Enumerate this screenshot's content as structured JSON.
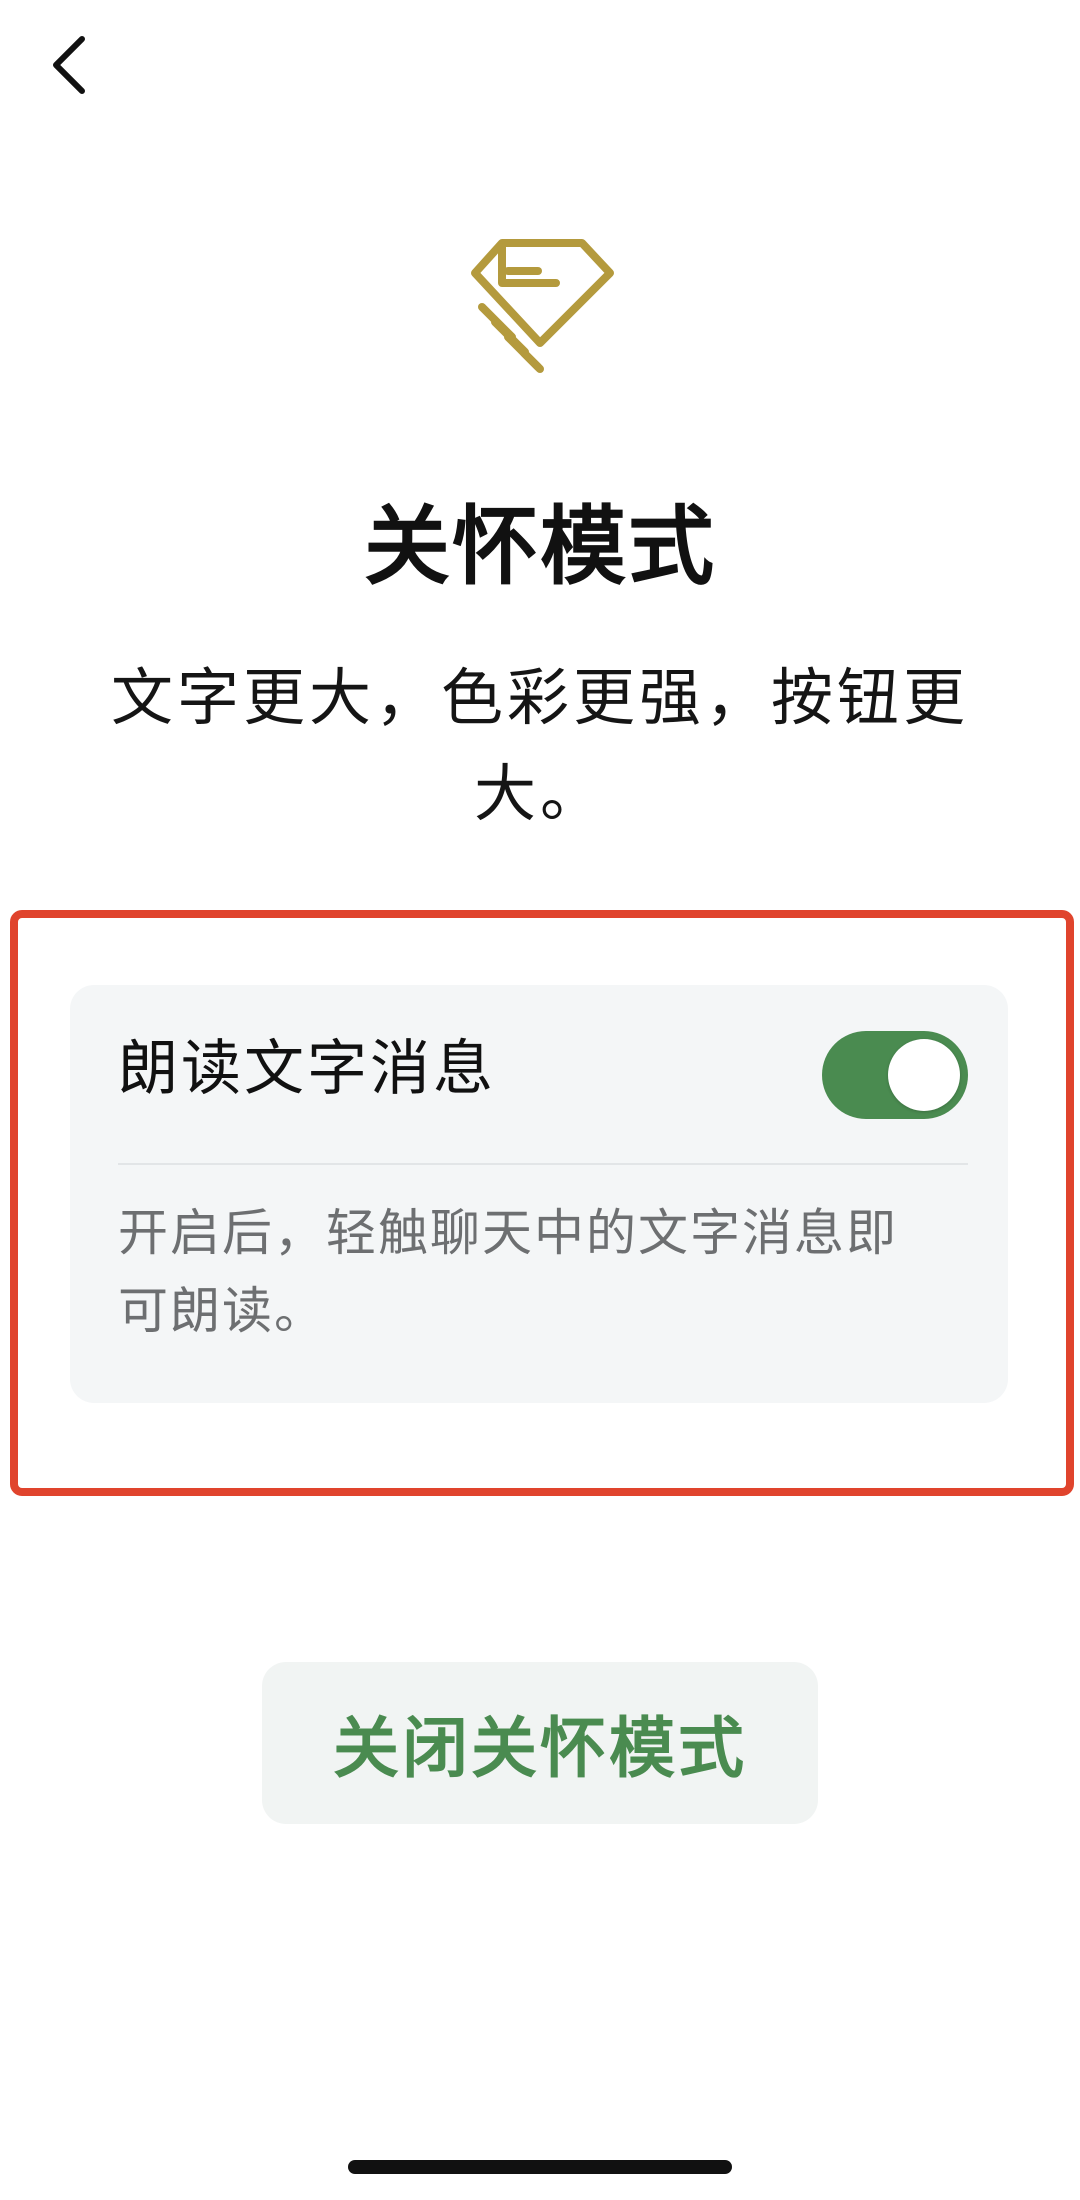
{
  "header": {
    "back_icon": "chevron-left-icon"
  },
  "hero": {
    "icon": "care-heart-hand-icon",
    "icon_color": "#b49a3d"
  },
  "page": {
    "title": "关怀模式",
    "subtitle": "文字更大，色彩更强，按钮更大。"
  },
  "setting": {
    "label": "朗读文字消息",
    "toggle_on": true,
    "description": "开启后，轻触聊天中的文字消息即可朗读。"
  },
  "actions": {
    "close_mode_label": "关闭关怀模式"
  },
  "colors": {
    "accent_green": "#4a8b50",
    "highlight_red": "#e0442d",
    "card_background": "#f4f6f7"
  }
}
